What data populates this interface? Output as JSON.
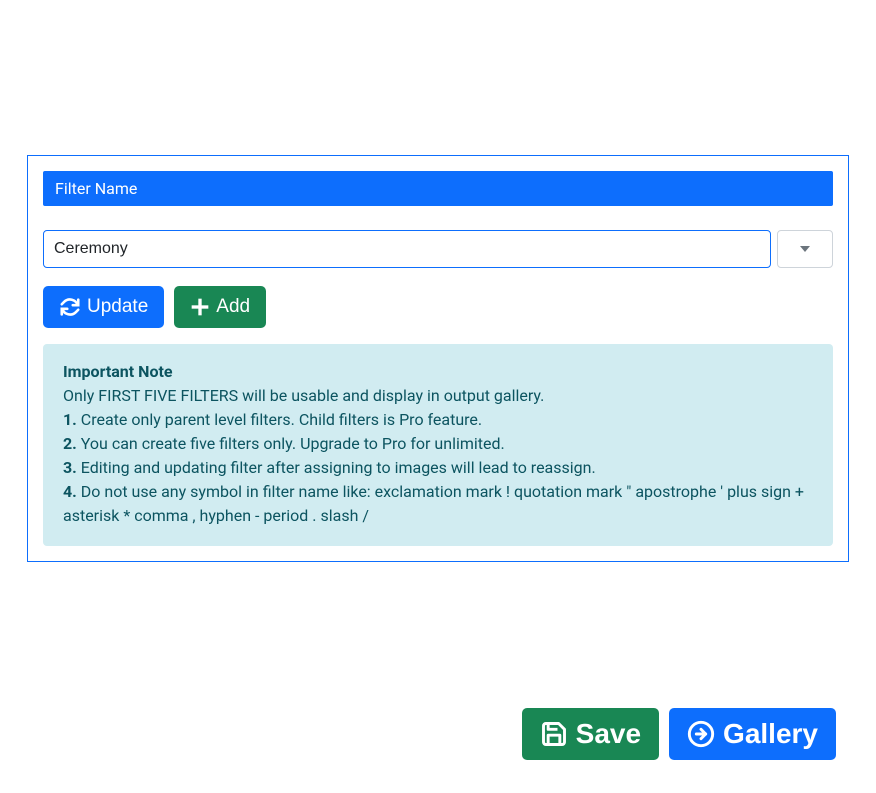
{
  "header": {
    "title": "Filter Name"
  },
  "input": {
    "value": "Ceremony"
  },
  "buttons": {
    "update": "Update",
    "add": "Add",
    "save": "Save",
    "gallery": "Gallery"
  },
  "note": {
    "title": "Important Note",
    "intro": "Only FIRST FIVE FILTERS will be usable and display in output gallery.",
    "items": [
      "Create only parent level filters. Child filters is Pro feature.",
      "You can create five filters only. Upgrade to Pro for unlimited.",
      "Editing and updating filter after assigning to images will lead to reassign.",
      "Do not use any symbol in filter name like: exclamation mark ! quotation mark \" apostrophe ' plus sign + asterisk * comma , hyphen - period . slash /"
    ]
  }
}
